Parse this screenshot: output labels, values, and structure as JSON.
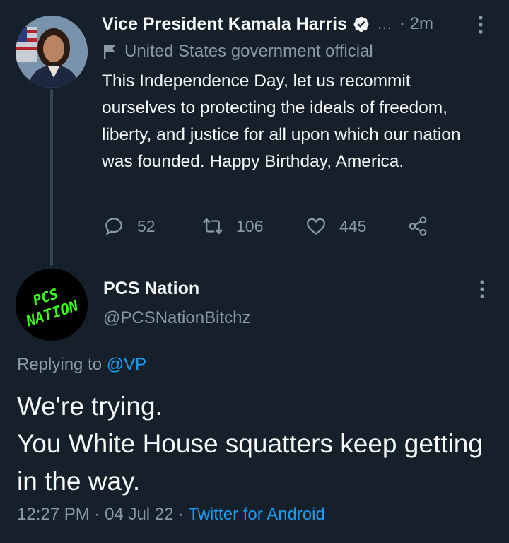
{
  "parent": {
    "name": "Vice President Kamala Harris",
    "ellipsis": "…",
    "time": "· 2m",
    "role": "United States government official",
    "text": "This Independence Day, let us recommit ourselves to protecting the ideals of freedom, liberty, and justice for all upon which our nation was founded. Happy Birthday, America.",
    "replies": "52",
    "retweets": "106",
    "likes": "445"
  },
  "reply": {
    "name": "PCS Nation",
    "handle": "@PCSNationBitchz",
    "avatar_text_1": "PCS",
    "avatar_text_2": "NATION",
    "replying_prefix": "Replying to",
    "replying_to": "@VP",
    "text_line1": "We're trying.",
    "text_line2": "You White House squatters keep getting in the way.",
    "time": "12:27 PM",
    "sep1": "·",
    "date": "04 Jul 22",
    "sep2": "·",
    "source": "Twitter for Android"
  },
  "colors": {
    "background": "#15202b",
    "text": "#f7f9f9",
    "muted": "#8b98a5",
    "link": "#1d9bf0",
    "avatar_green": "#39ff14"
  },
  "icons": [
    "verified-badge-icon",
    "flag-icon",
    "more-vertical-icon",
    "reply-icon",
    "retweet-icon",
    "like-icon",
    "share-icon"
  ]
}
